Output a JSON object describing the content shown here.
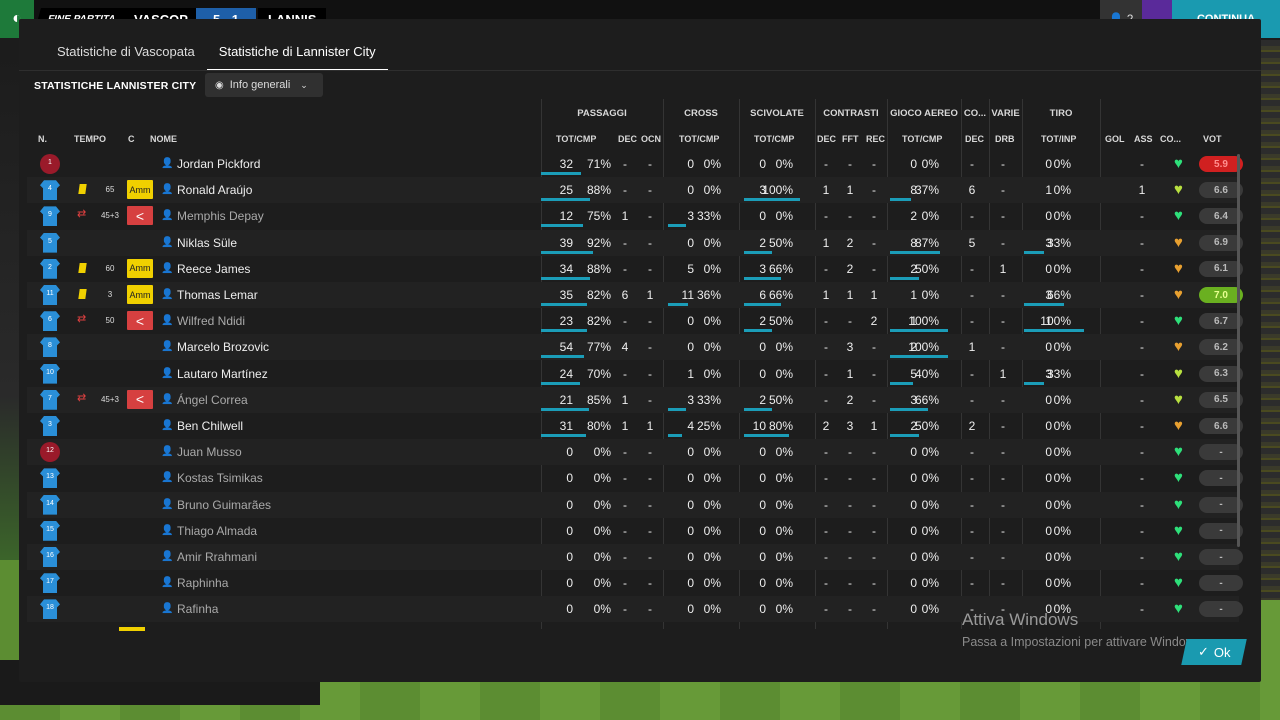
{
  "topbar": {
    "fine_label": "FINE PARTITA",
    "home": "VASCOP",
    "score": "5 - 1",
    "away": "LANNIS",
    "players_count": "2",
    "continue_label": "CONTINUA"
  },
  "tabs": [
    "Statistiche di Vascopata",
    "Statistiche di Lannister City"
  ],
  "section_title": "STATISTICHE LANNISTER CITY",
  "filter_label": "Info generali",
  "groups": {
    "passaggi": "PASSAGGI",
    "cross": "CROSS",
    "scivolate": "SCIVOLATE",
    "contrasti": "CONTRASTI",
    "gioco_aereo": "GIOCO AEREO",
    "co": "CO...",
    "varie": "VARIE",
    "tiro": "TIRO"
  },
  "headers": {
    "n": "N.",
    "tempo": "TEMPO",
    "c": "C",
    "nome": "NOME",
    "pass_tc": "TOT/CMP",
    "pass_dec": "DEC",
    "pass_ocn": "OCN",
    "cross_tc": "TOT/CMP",
    "sciv_tc": "TOT/CMP",
    "contr_dec": "DEC",
    "contr_fft": "FFT",
    "contr_rec": "REC",
    "aereo_tc": "TOT/CMP",
    "co_dec": "DEC",
    "varie_drb": "DRB",
    "tiro_ti": "TOT/INP",
    "gol": "GOL",
    "ass": "ASS",
    "cond": "CO...",
    "voto": "VOT"
  },
  "players": [
    {
      "num": "1",
      "gk": true,
      "card": false,
      "sub": false,
      "time": "",
      "c": "",
      "name": "Jordan Pickford",
      "pt": "32",
      "pp": "71%",
      "pd": "-",
      "po": "-",
      "ct": "0",
      "cp": "0%",
      "st": "0",
      "sp": "0%",
      "kd": "-",
      "kf": "-",
      "kr": "-",
      "at": "0",
      "ap": "0%",
      "cd": "-",
      "dr": "-",
      "tt": "0",
      "tp": "0%",
      "g": "",
      "a": "-",
      "heart": "green",
      "vote": "5.9",
      "vc": "red",
      "p_bar": 0.71,
      "c_bar": 0,
      "s_bar": 0,
      "a_bar": 0,
      "t_bar": 0
    },
    {
      "num": "4",
      "gk": false,
      "card": true,
      "sub": false,
      "time": "65",
      "c": "Amm",
      "name": "Ronald Araújo",
      "pt": "25",
      "pp": "88%",
      "pd": "-",
      "po": "-",
      "ct": "0",
      "cp": "0%",
      "st": "3",
      "sp": "100%",
      "kd": "1",
      "kf": "1",
      "kr": "-",
      "at": "8",
      "ap": "37%",
      "cd": "6",
      "dr": "-",
      "tt": "1",
      "tp": "0%",
      "g": "",
      "a": "1",
      "heart": "yellowgreen",
      "vote": "6.6",
      "vc": "",
      "p_bar": 0.88,
      "c_bar": 0,
      "s_bar": 1,
      "a_bar": 0.37,
      "t_bar": 0
    },
    {
      "num": "9",
      "gk": false,
      "card": false,
      "sub": true,
      "time": "45+3",
      "c": "<",
      "name": "Memphis Depay",
      "pt": "12",
      "pp": "75%",
      "pd": "1",
      "po": "-",
      "ct": "3",
      "cp": "33%",
      "st": "0",
      "sp": "0%",
      "kd": "-",
      "kf": "-",
      "kr": "-",
      "at": "2",
      "ap": "0%",
      "cd": "-",
      "dr": "-",
      "tt": "0",
      "tp": "0%",
      "g": "",
      "a": "-",
      "heart": "green",
      "vote": "6.4",
      "vc": "",
      "p_bar": 0.75,
      "c_bar": 0.33,
      "s_bar": 0,
      "a_bar": 0,
      "t_bar": 0
    },
    {
      "num": "5",
      "gk": false,
      "card": false,
      "sub": false,
      "time": "",
      "c": "",
      "name": "Niklas Süle",
      "pt": "39",
      "pp": "92%",
      "pd": "-",
      "po": "-",
      "ct": "0",
      "cp": "0%",
      "st": "2",
      "sp": "50%",
      "kd": "1",
      "kf": "2",
      "kr": "-",
      "at": "8",
      "ap": "87%",
      "cd": "5",
      "dr": "-",
      "tt": "3",
      "tp": "33%",
      "g": "",
      "a": "-",
      "heart": "orange",
      "vote": "6.9",
      "vc": "",
      "p_bar": 0.92,
      "c_bar": 0,
      "s_bar": 0.5,
      "a_bar": 0.87,
      "t_bar": 0.33
    },
    {
      "num": "2",
      "gk": false,
      "card": true,
      "sub": false,
      "time": "60",
      "c": "Amm",
      "name": "Reece James",
      "pt": "34",
      "pp": "88%",
      "pd": "-",
      "po": "-",
      "ct": "5",
      "cp": "0%",
      "st": "3",
      "sp": "66%",
      "kd": "-",
      "kf": "2",
      "kr": "-",
      "at": "2",
      "ap": "50%",
      "cd": "-",
      "dr": "1",
      "tt": "0",
      "tp": "0%",
      "g": "",
      "a": "-",
      "heart": "orange",
      "vote": "6.1",
      "vc": "",
      "p_bar": 0.88,
      "c_bar": 0,
      "s_bar": 0.66,
      "a_bar": 0.5,
      "t_bar": 0
    },
    {
      "num": "11",
      "gk": false,
      "card": true,
      "sub": false,
      "time": "3",
      "c": "Amm",
      "name": "Thomas Lemar",
      "pt": "35",
      "pp": "82%",
      "pd": "6",
      "po": "1",
      "ct": "11",
      "cp": "36%",
      "st": "6",
      "sp": "66%",
      "kd": "1",
      "kf": "1",
      "kr": "1",
      "at": "1",
      "ap": "0%",
      "cd": "-",
      "dr": "-",
      "tt": "3",
      "tp": "66%",
      "g": "",
      "a": "-",
      "heart": "orange",
      "vote": "7.0",
      "vc": "green",
      "p_bar": 0.82,
      "c_bar": 0.36,
      "s_bar": 0.66,
      "a_bar": 0,
      "t_bar": 0.66
    },
    {
      "num": "6",
      "gk": false,
      "card": false,
      "sub": true,
      "time": "50",
      "c": "<",
      "name": "Wilfred Ndidi",
      "pt": "23",
      "pp": "82%",
      "pd": "-",
      "po": "-",
      "ct": "0",
      "cp": "0%",
      "st": "2",
      "sp": "50%",
      "kd": "-",
      "kf": "-",
      "kr": "2",
      "at": "1",
      "ap": "100%",
      "cd": "-",
      "dr": "-",
      "tt": "1",
      "tp": "100%",
      "g": "",
      "a": "-",
      "heart": "green",
      "vote": "6.7",
      "vc": "",
      "p_bar": 0.82,
      "c_bar": 0,
      "s_bar": 0.5,
      "a_bar": 1,
      "t_bar": 1
    },
    {
      "num": "8",
      "gk": false,
      "card": false,
      "sub": false,
      "time": "",
      "c": "",
      "name": "Marcelo Brozovic",
      "pt": "54",
      "pp": "77%",
      "pd": "4",
      "po": "-",
      "ct": "0",
      "cp": "0%",
      "st": "0",
      "sp": "0%",
      "kd": "-",
      "kf": "3",
      "kr": "-",
      "at": "2",
      "ap": "100%",
      "cd": "1",
      "dr": "-",
      "tt": "0",
      "tp": "0%",
      "g": "",
      "a": "-",
      "heart": "orange",
      "vote": "6.2",
      "vc": "",
      "p_bar": 0.77,
      "c_bar": 0,
      "s_bar": 0,
      "a_bar": 1,
      "t_bar": 0
    },
    {
      "num": "10",
      "gk": false,
      "card": false,
      "sub": false,
      "time": "",
      "c": "",
      "name": "Lautaro Martínez",
      "pt": "24",
      "pp": "70%",
      "pd": "-",
      "po": "-",
      "ct": "1",
      "cp": "0%",
      "st": "0",
      "sp": "0%",
      "kd": "-",
      "kf": "1",
      "kr": "-",
      "at": "5",
      "ap": "40%",
      "cd": "-",
      "dr": "1",
      "tt": "3",
      "tp": "33%",
      "g": "",
      "a": "-",
      "heart": "yellowgreen",
      "vote": "6.3",
      "vc": "",
      "p_bar": 0.7,
      "c_bar": 0,
      "s_bar": 0,
      "a_bar": 0.4,
      "t_bar": 0.33
    },
    {
      "num": "7",
      "gk": false,
      "card": false,
      "sub": true,
      "time": "45+3",
      "c": "<",
      "name": "Ángel Correa",
      "pt": "21",
      "pp": "85%",
      "pd": "1",
      "po": "-",
      "ct": "3",
      "cp": "33%",
      "st": "2",
      "sp": "50%",
      "kd": "-",
      "kf": "2",
      "kr": "-",
      "at": "3",
      "ap": "66%",
      "cd": "-",
      "dr": "-",
      "tt": "0",
      "tp": "0%",
      "g": "",
      "a": "-",
      "heart": "yellowgreen",
      "vote": "6.5",
      "vc": "",
      "p_bar": 0.85,
      "c_bar": 0.33,
      "s_bar": 0.5,
      "a_bar": 0.66,
      "t_bar": 0
    },
    {
      "num": "3",
      "gk": false,
      "card": false,
      "sub": false,
      "time": "",
      "c": "",
      "name": "Ben Chilwell",
      "pt": "31",
      "pp": "80%",
      "pd": "1",
      "po": "1",
      "ct": "4",
      "cp": "25%",
      "st": "10",
      "sp": "80%",
      "kd": "2",
      "kf": "3",
      "kr": "1",
      "at": "2",
      "ap": "50%",
      "cd": "2",
      "dr": "-",
      "tt": "0",
      "tp": "0%",
      "g": "",
      "a": "-",
      "heart": "orange",
      "vote": "6.6",
      "vc": "",
      "p_bar": 0.8,
      "c_bar": 0.25,
      "s_bar": 0.8,
      "a_bar": 0.5,
      "t_bar": 0
    },
    {
      "num": "12",
      "gk": true,
      "card": false,
      "sub": false,
      "time": "",
      "c": "",
      "name": "Juan Musso",
      "pt": "0",
      "pp": "0%",
      "pd": "-",
      "po": "-",
      "ct": "0",
      "cp": "0%",
      "st": "0",
      "sp": "0%",
      "kd": "-",
      "kf": "-",
      "kr": "-",
      "at": "0",
      "ap": "0%",
      "cd": "-",
      "dr": "-",
      "tt": "0",
      "tp": "0%",
      "g": "",
      "a": "-",
      "heart": "green",
      "vote": "-",
      "vc": "",
      "p_bar": 0,
      "c_bar": 0,
      "s_bar": 0,
      "a_bar": 0,
      "t_bar": 0,
      "bench": true
    },
    {
      "num": "13",
      "gk": false,
      "card": false,
      "sub": false,
      "time": "",
      "c": "",
      "name": "Kostas Tsimikas",
      "pt": "0",
      "pp": "0%",
      "pd": "-",
      "po": "-",
      "ct": "0",
      "cp": "0%",
      "st": "0",
      "sp": "0%",
      "kd": "-",
      "kf": "-",
      "kr": "-",
      "at": "0",
      "ap": "0%",
      "cd": "-",
      "dr": "-",
      "tt": "0",
      "tp": "0%",
      "g": "",
      "a": "-",
      "heart": "green",
      "vote": "-",
      "vc": "",
      "p_bar": 0,
      "c_bar": 0,
      "s_bar": 0,
      "a_bar": 0,
      "t_bar": 0,
      "bench": true
    },
    {
      "num": "14",
      "gk": false,
      "card": false,
      "sub": false,
      "time": "",
      "c": "",
      "name": "Bruno Guimarães",
      "pt": "0",
      "pp": "0%",
      "pd": "-",
      "po": "-",
      "ct": "0",
      "cp": "0%",
      "st": "0",
      "sp": "0%",
      "kd": "-",
      "kf": "-",
      "kr": "-",
      "at": "0",
      "ap": "0%",
      "cd": "-",
      "dr": "-",
      "tt": "0",
      "tp": "0%",
      "g": "",
      "a": "-",
      "heart": "green",
      "vote": "-",
      "vc": "",
      "p_bar": 0,
      "c_bar": 0,
      "s_bar": 0,
      "a_bar": 0,
      "t_bar": 0,
      "bench": true
    },
    {
      "num": "15",
      "gk": false,
      "card": false,
      "sub": false,
      "time": "",
      "c": "",
      "name": "Thiago Almada",
      "pt": "0",
      "pp": "0%",
      "pd": "-",
      "po": "-",
      "ct": "0",
      "cp": "0%",
      "st": "0",
      "sp": "0%",
      "kd": "-",
      "kf": "-",
      "kr": "-",
      "at": "0",
      "ap": "0%",
      "cd": "-",
      "dr": "-",
      "tt": "0",
      "tp": "0%",
      "g": "",
      "a": "-",
      "heart": "green",
      "vote": "-",
      "vc": "",
      "p_bar": 0,
      "c_bar": 0,
      "s_bar": 0,
      "a_bar": 0,
      "t_bar": 0,
      "bench": true
    },
    {
      "num": "16",
      "gk": false,
      "card": false,
      "sub": false,
      "time": "",
      "c": "",
      "name": "Amir Rrahmani",
      "pt": "0",
      "pp": "0%",
      "pd": "-",
      "po": "-",
      "ct": "0",
      "cp": "0%",
      "st": "0",
      "sp": "0%",
      "kd": "-",
      "kf": "-",
      "kr": "-",
      "at": "0",
      "ap": "0%",
      "cd": "-",
      "dr": "-",
      "tt": "0",
      "tp": "0%",
      "g": "",
      "a": "-",
      "heart": "green",
      "vote": "-",
      "vc": "",
      "p_bar": 0,
      "c_bar": 0,
      "s_bar": 0,
      "a_bar": 0,
      "t_bar": 0,
      "bench": true
    },
    {
      "num": "17",
      "gk": false,
      "card": false,
      "sub": false,
      "time": "",
      "c": "",
      "name": "Raphinha",
      "pt": "0",
      "pp": "0%",
      "pd": "-",
      "po": "-",
      "ct": "0",
      "cp": "0%",
      "st": "0",
      "sp": "0%",
      "kd": "-",
      "kf": "-",
      "kr": "-",
      "at": "0",
      "ap": "0%",
      "cd": "-",
      "dr": "-",
      "tt": "0",
      "tp": "0%",
      "g": "",
      "a": "-",
      "heart": "green",
      "vote": "-",
      "vc": "",
      "p_bar": 0,
      "c_bar": 0,
      "s_bar": 0,
      "a_bar": 0,
      "t_bar": 0,
      "bench": true
    },
    {
      "num": "18",
      "gk": false,
      "card": false,
      "sub": false,
      "time": "",
      "c": "",
      "name": "Rafinha",
      "pt": "0",
      "pp": "0%",
      "pd": "-",
      "po": "-",
      "ct": "0",
      "cp": "0%",
      "st": "0",
      "sp": "0%",
      "kd": "-",
      "kf": "-",
      "kr": "-",
      "at": "0",
      "ap": "0%",
      "cd": "-",
      "dr": "-",
      "tt": "0",
      "tp": "0%",
      "g": "",
      "a": "-",
      "heart": "green",
      "vote": "-",
      "vc": "",
      "p_bar": 0,
      "c_bar": 0,
      "s_bar": 0,
      "a_bar": 0,
      "t_bar": 0,
      "bench": true
    }
  ],
  "watermark": {
    "line1": "Attiva Windows",
    "line2": "Passa a Impostazioni per attivare Windows."
  },
  "ok_label": "Ok",
  "colors": {
    "accent": "#1b9db8",
    "yellow_card": "#f0d000",
    "sub_out": "#d64040",
    "heart_green": "#2ee07a",
    "heart_orange": "#e8a030",
    "heart_yellowgreen": "#b8e040"
  }
}
